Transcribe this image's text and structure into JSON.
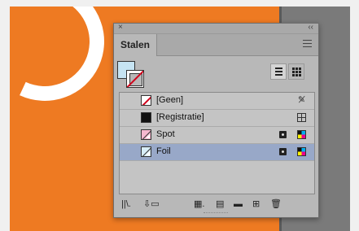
{
  "panel": {
    "close_glyph": "×",
    "collapse_glyph": "‹‹",
    "tab_label": "Stalen",
    "menu_icon": "hamburger-icon"
  },
  "colors": {
    "canvas_orange": "#ee7a22",
    "selected_row": "#98a8c8",
    "fill_color": "#c6e4f3",
    "stroke_none": "#d0021b"
  },
  "swatches": [
    {
      "label": "[Geen]",
      "chip": "none",
      "right_icon": "no-edit-icon"
    },
    {
      "label": "[Registratie]",
      "chip": "registration",
      "right_icon": "registration-icon"
    },
    {
      "label": "Spot",
      "chip": "spot",
      "type_icon": "spot-icon",
      "mode_icon": "cmyk-icon"
    },
    {
      "label": "Foil",
      "chip": "foil",
      "type_icon": "spot-icon",
      "mode_icon": "cmyk-icon",
      "selected": true
    }
  ],
  "footer_icons": [
    "library-icon",
    "import-swatch-icon",
    "color-group-icon",
    "swatch-options-icon",
    "folder-icon",
    "new-swatch-icon",
    "trash-icon"
  ]
}
